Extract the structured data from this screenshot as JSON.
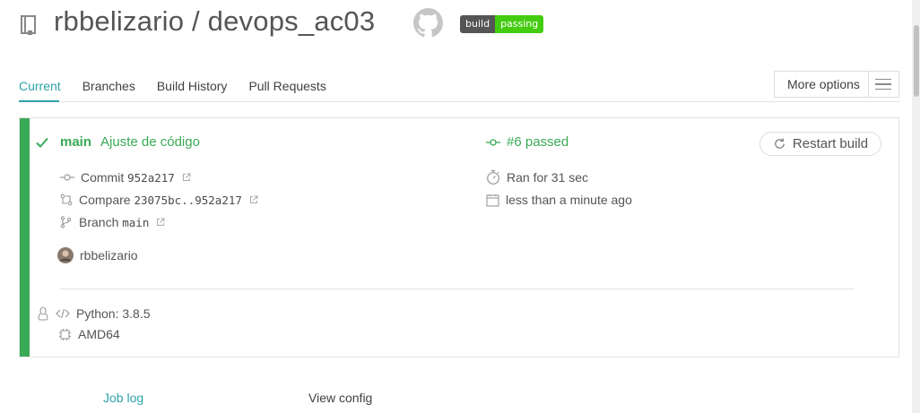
{
  "header": {
    "repo_owner": "rbbelizario",
    "separator": " / ",
    "repo_name": "devops_ac03",
    "badge": {
      "left": "build",
      "right": "passing",
      "left_color": "#555555",
      "right_color": "#44cc11"
    },
    "icons": {
      "repo": "repo-icon",
      "github": "github-icon"
    }
  },
  "tabs": [
    {
      "label": "Current",
      "active": true
    },
    {
      "label": "Branches",
      "active": false
    },
    {
      "label": "Build History",
      "active": false
    },
    {
      "label": "Pull Requests",
      "active": false
    }
  ],
  "more_options": {
    "label": "More options"
  },
  "build": {
    "status": "passed",
    "status_color": "#39aa56",
    "branch": "main",
    "message": "Ajuste de código",
    "number_label": "#6 passed",
    "restart_label": "Restart build",
    "commit": {
      "label": "Commit",
      "value": "952a217"
    },
    "compare": {
      "label": "Compare",
      "value": "23075bc..952a217"
    },
    "branch_ref": {
      "label": "Branch",
      "value": "main"
    },
    "duration": "Ran for 31 sec",
    "finished": "less than a minute ago",
    "author": "rbbelizario",
    "language": "Python: 3.8.5",
    "arch": "AMD64"
  },
  "bottom_tabs": {
    "job_log": "Job log",
    "view_config": "View config"
  },
  "colors": {
    "accent": "#2fa3a8",
    "success": "#39aa56"
  }
}
